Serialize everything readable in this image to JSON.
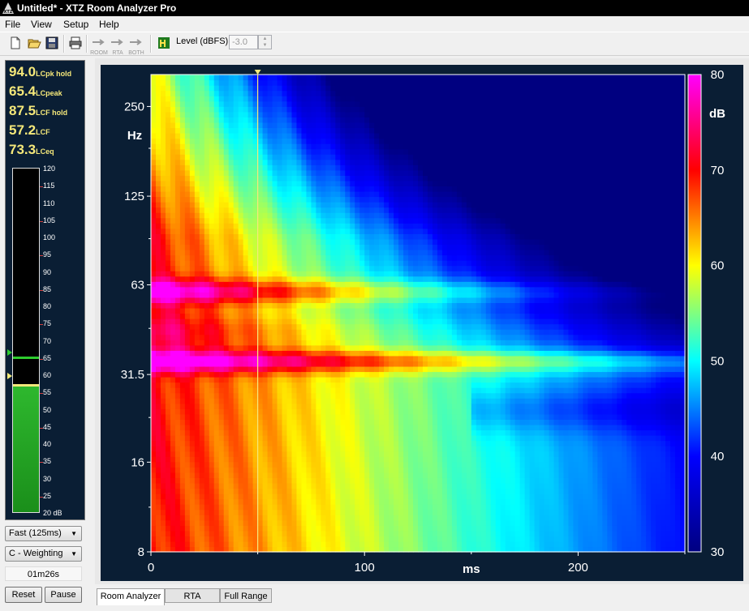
{
  "window": {
    "title": "Untitled* - XTZ Room Analyzer Pro"
  },
  "menu": [
    "File",
    "View",
    "Setup",
    "Help"
  ],
  "toolbar": {
    "buttons": [
      {
        "name": "new-file-icon",
        "label": ""
      },
      {
        "name": "open-folder-icon",
        "label": ""
      },
      {
        "name": "save-icon",
        "label": ""
      },
      {
        "name": "print-icon",
        "label": ""
      },
      {
        "name": "room-icon",
        "label": "ROOM"
      },
      {
        "name": "rta-icon",
        "label": "RTA"
      },
      {
        "name": "both-icon",
        "label": "BOTH"
      }
    ],
    "level_label": "Level (dBFS)",
    "level_value": "-3.0"
  },
  "readouts": [
    {
      "value": "94.0",
      "unit": "LCpk hold"
    },
    {
      "value": "65.4",
      "unit": "LCpeak"
    },
    {
      "value": "87.5",
      "unit": "LCF hold"
    },
    {
      "value": "57.2",
      "unit": "LCF"
    },
    {
      "value": "73.3",
      "unit": "LCeq"
    }
  ],
  "meter": {
    "scale": [
      "120",
      "115",
      "110",
      "105",
      "100",
      "95",
      "90",
      "85",
      "80",
      "75",
      "70",
      "65",
      "60",
      "55",
      "50",
      "45",
      "40",
      "35",
      "30",
      "25",
      "20 dB"
    ],
    "level_db": 57.2,
    "hold_db": 65.4,
    "min_db": 20,
    "max_db": 120
  },
  "controls": {
    "speed": "Fast (125ms)",
    "weighting": "C - Weighting",
    "elapsed": "01m26s",
    "reset": "Reset",
    "pause": "Pause"
  },
  "chart_data": {
    "type": "heatmap",
    "title": "",
    "xlabel": "ms",
    "ylabel": "Hz",
    "x_ticks": [
      "0",
      "100",
      "200"
    ],
    "y_ticks": [
      "250",
      "125",
      "63",
      "31.5",
      "16",
      "8"
    ],
    "xlim": [
      0,
      250
    ],
    "ylim_hz": [
      8,
      320
    ],
    "y_scale": "log",
    "colorbar_label": "dB",
    "colorbar_ticks": [
      "80",
      "70",
      "60",
      "50",
      "40",
      "30"
    ],
    "color_range_db": [
      30,
      80
    ],
    "cursor_ms": 50
  },
  "tabs": [
    "Room Analyzer",
    "RTA",
    "Full Range"
  ],
  "active_tab": "Room Analyzer"
}
